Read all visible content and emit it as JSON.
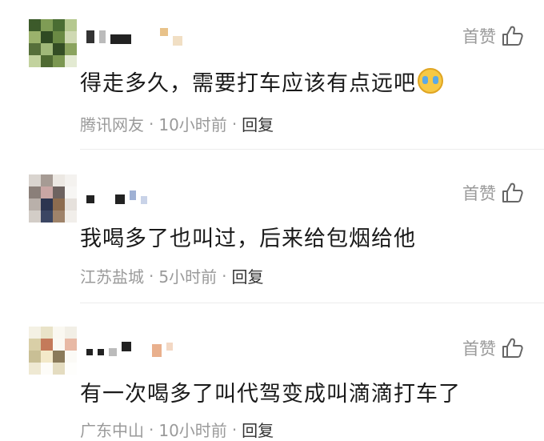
{
  "like_label": "首赞",
  "comments": [
    {
      "text": "得走多久，需要打车应该有点远吧",
      "emoji": "crying-face",
      "location": "腾讯网友",
      "time": "10小时前",
      "reply_label": "回复"
    },
    {
      "text": "我喝多了也叫过，后来给包烟给他",
      "location": "江苏盐城",
      "time": "5小时前",
      "reply_label": "回复"
    },
    {
      "text": "有一次喝多了叫代驾变成叫滴滴打车了",
      "location": "广东中山",
      "time": "10小时前",
      "reply_label": "回复"
    }
  ],
  "meta_separator": "·",
  "colors": {
    "secondary_text": "#9a9a9a",
    "primary_text": "#1a1a1a",
    "divider": "#ececec"
  }
}
